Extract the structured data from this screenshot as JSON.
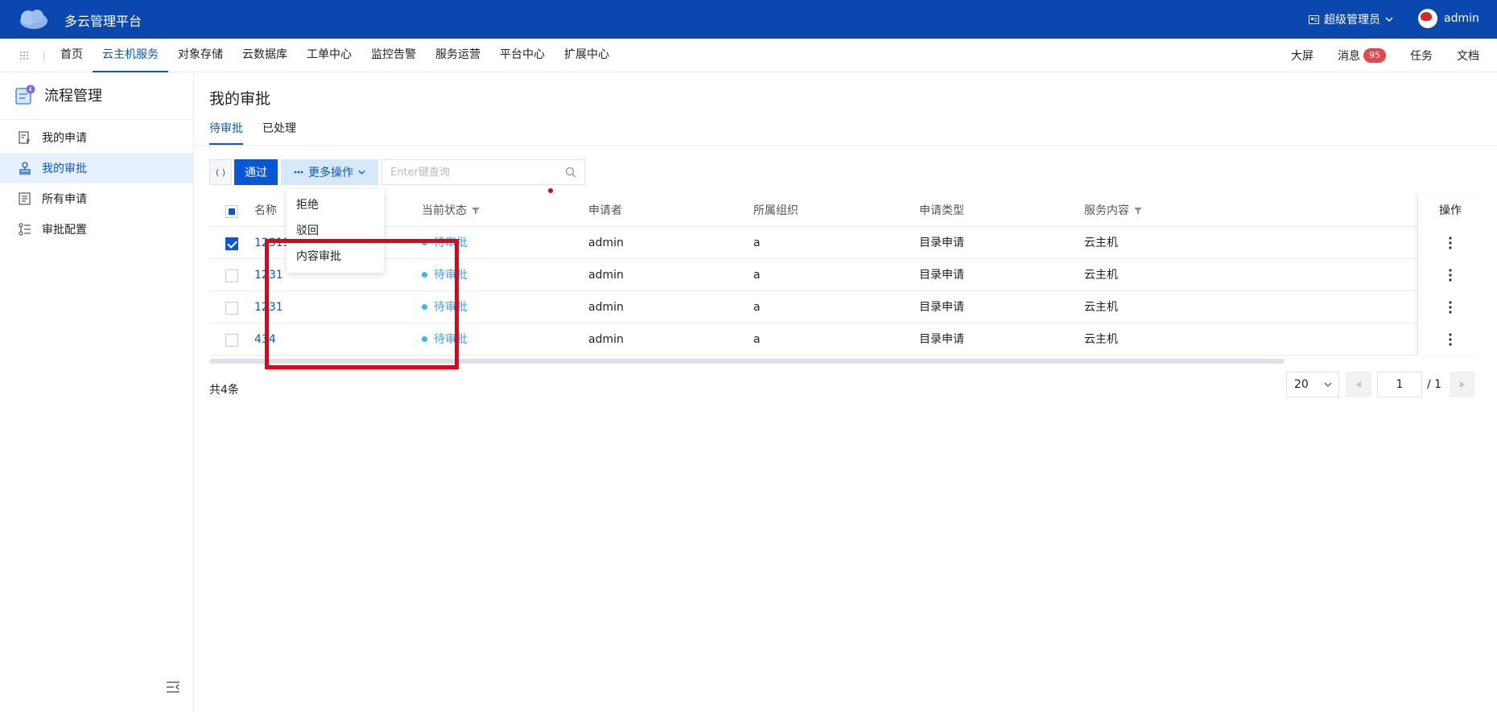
{
  "app": {
    "title": "多云管理平台"
  },
  "topbar": {
    "role": "超级管理员",
    "user": "admin"
  },
  "nav": {
    "items": [
      "首页",
      "云主机服务",
      "对象存储",
      "云数据库",
      "工单中心",
      "监控告警",
      "服务运营",
      "平台中心",
      "扩展中心"
    ],
    "active_index": 1,
    "right": {
      "screen": "大屏",
      "messages": "消息",
      "message_count": "95",
      "tasks": "任务",
      "docs": "文档"
    }
  },
  "sidebar": {
    "title": "流程管理",
    "items": [
      {
        "label": "我的申请",
        "icon": "apply-icon"
      },
      {
        "label": "我的审批",
        "icon": "stamp-icon",
        "active": true
      },
      {
        "label": "所有申请",
        "icon": "list-icon"
      },
      {
        "label": "审批配置",
        "icon": "config-icon"
      }
    ]
  },
  "main": {
    "title": "我的审批",
    "tabs": [
      "待审批",
      "已处理"
    ],
    "toolbar": {
      "refresh_label": "( )",
      "approve_label": "通过",
      "more_label": "更多操作",
      "search_placeholder": "Enter键查询"
    },
    "more_menu": [
      "拒绝",
      "驳回",
      "内容审批"
    ],
    "table": {
      "columns": [
        "名称",
        "当前状态",
        "申请者",
        "所属组织",
        "申请类型",
        "服务内容",
        "操作"
      ],
      "rows": [
        {
          "name": "12313",
          "status": "待审批",
          "applicant": "admin",
          "org": "a",
          "type": "目录申请",
          "content": "云主机",
          "checked": true
        },
        {
          "name": "1231",
          "status": "待审批",
          "applicant": "admin",
          "org": "a",
          "type": "目录申请",
          "content": "云主机",
          "checked": false
        },
        {
          "name": "1231",
          "status": "待审批",
          "applicant": "admin",
          "org": "a",
          "type": "目录申请",
          "content": "云主机",
          "checked": false
        },
        {
          "name": "434",
          "status": "待审批",
          "applicant": "admin",
          "org": "a",
          "type": "目录申请",
          "content": "云主机",
          "checked": false
        }
      ]
    },
    "pagination": {
      "total": "共4条",
      "page_size": "20",
      "current_page": "1",
      "total_pages": "/ 1"
    }
  },
  "colors": {
    "topbar": "#0a48b0",
    "primary": "#0a57d6",
    "status": "#3aa0f0",
    "highlight": "#e60012"
  }
}
